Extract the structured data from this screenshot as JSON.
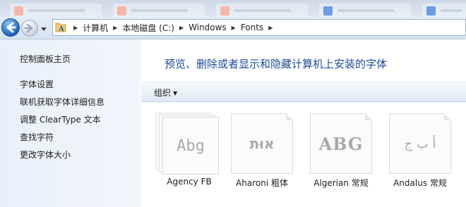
{
  "address": {
    "segments": [
      "计算机",
      "本地磁盘 (C:)",
      "Windows",
      "Fonts"
    ]
  },
  "sidebar": {
    "home": "控制面板主页",
    "links": [
      "字体设置",
      "联机获取字体详细信息",
      "调整 ClearType 文本",
      "查找字符",
      "更改字体大小"
    ]
  },
  "main": {
    "heading": "预览、删除或者显示和隐藏计算机上安装的字体",
    "toolbar": {
      "organize": "组织"
    }
  },
  "fonts": [
    {
      "name": "Agency FB",
      "sample": "Abg"
    },
    {
      "name": "Aharoni 粗体",
      "sample": "אוּת"
    },
    {
      "name": "Algerian 常规",
      "sample": "ABG"
    },
    {
      "name": "Andalus 常规",
      "sample": "أ ب ج"
    }
  ],
  "icons": {
    "back": "back-arrow-icon",
    "forward": "forward-arrow-icon",
    "history": "history-dropdown-icon",
    "folder": "fonts-folder-icon",
    "chevron": "breadcrumb-chevron-icon",
    "organize_caret": "caret-down-icon"
  },
  "colors": {
    "heading": "#1e4b9a",
    "sidebar_bg": "#e9f0fa",
    "toolbar_bg": "#dfe9f5",
    "sample_text": "#a9a9a9"
  }
}
